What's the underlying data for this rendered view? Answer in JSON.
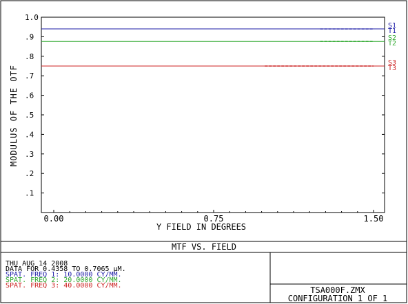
{
  "chart_data": {
    "type": "line",
    "title": "MTF VS. FIELD",
    "xlabel": "Y FIELD IN DEGREES",
    "ylabel": "MODULUS OF THE OTF",
    "xlim": [
      0,
      1.5
    ],
    "ylim": [
      0,
      1.0
    ],
    "x_ticks": [
      "0.00",
      "0.75",
      "1.50"
    ],
    "y_ticks": [
      ".1",
      ".2",
      ".3",
      ".4",
      ".5",
      ".6",
      ".7",
      ".8",
      ".9",
      "1.0"
    ],
    "series": [
      {
        "name": "S1",
        "color": "#1a1aa6",
        "style": "solid",
        "x": [
          0,
          1.5
        ],
        "y": [
          0.94,
          0.94
        ]
      },
      {
        "name": "T1",
        "color": "#1a1aa6",
        "style": "dashed",
        "x": [
          1.25,
          1.5
        ],
        "y": [
          0.94,
          0.94
        ]
      },
      {
        "name": "S2",
        "color": "#2ea82e",
        "style": "solid",
        "x": [
          0,
          1.5
        ],
        "y": [
          0.876,
          0.876
        ]
      },
      {
        "name": "T2",
        "color": "#2ea82e",
        "style": "dashed",
        "x": [
          1.25,
          1.5
        ],
        "y": [
          0.876,
          0.876
        ]
      },
      {
        "name": "S3",
        "color": "#cc2222",
        "style": "solid",
        "x": [
          0,
          1.5
        ],
        "y": [
          0.75,
          0.75
        ]
      },
      {
        "name": "T3",
        "color": "#cc2222",
        "style": "dashed",
        "x": [
          0.99,
          1.5
        ],
        "y": [
          0.75,
          0.75
        ]
      }
    ],
    "legend_placement": "right"
  },
  "info": {
    "date": "THU AUG 14 2008",
    "data_range": "DATA FOR 0.4358 TO 0.7065 µM.",
    "freq1": "SPAT. FREQ 1:   10.0000 CY/MM.",
    "freq2": "SPAT. FREQ 2:   20.0000 CY/MM.",
    "freq3": "SPAT. FREQ 3:   40.0000 CY/MM."
  },
  "file": {
    "name": "TSA000F.ZMX",
    "configuration": "CONFIGURATION 1 OF 1"
  }
}
